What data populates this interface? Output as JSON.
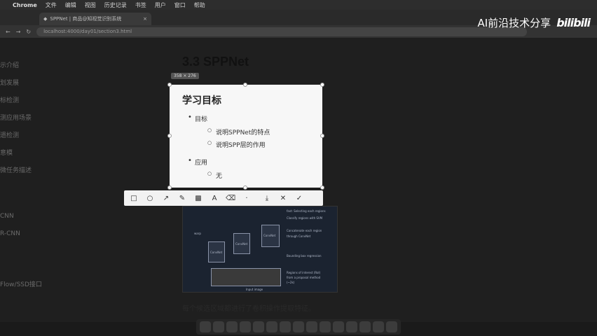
{
  "menubar": {
    "apple": "",
    "app": "Chrome",
    "items": [
      "文件",
      "编辑",
      "视图",
      "历史记录",
      "书签",
      "用户",
      "窗口",
      "帮助"
    ]
  },
  "tab": {
    "title": "SPPNet | 商品@知视觉识别系统",
    "close": "×"
  },
  "address": {
    "url": "localhost:4000/day01/section3.html"
  },
  "watermark": {
    "text": "AI前沿技术分享",
    "logo": "bilibili"
  },
  "sidebar": {
    "items": [
      "示介绍",
      "划发展",
      "标检测",
      "测应用场景",
      "遗检测",
      "意模",
      "微任务描述",
      "",
      "CNN",
      "R-CNN",
      "",
      "Flow/SSD接口"
    ]
  },
  "content": {
    "title": "3.3 SPPNet",
    "size_badge": "358 × 276",
    "caption": "每个候选区域都进行了卷积操作提取特征。"
  },
  "capture": {
    "heading": "学习目标",
    "items": [
      {
        "level": 1,
        "text": "目标"
      },
      {
        "level": 2,
        "text": "说明SPPNet的特点"
      },
      {
        "level": 2,
        "text": "说明SPP层的作用"
      },
      {
        "level": 1,
        "text": "应用"
      },
      {
        "level": 2,
        "text": "无"
      }
    ]
  },
  "toolbar": {
    "tools": [
      {
        "name": "rectangle-tool-icon",
        "glyph": "□"
      },
      {
        "name": "ellipse-tool-icon",
        "glyph": "○"
      },
      {
        "name": "arrow-tool-icon",
        "glyph": "↗"
      },
      {
        "name": "pen-tool-icon",
        "glyph": "✎"
      },
      {
        "name": "mosaic-tool-icon",
        "glyph": "▩"
      },
      {
        "name": "text-tool-icon",
        "glyph": "A"
      },
      {
        "name": "eraser-tool-icon",
        "glyph": "⌫"
      },
      {
        "name": "undo-icon",
        "glyph": "·"
      },
      {
        "name": "download-icon",
        "glyph": "⤓"
      },
      {
        "name": "cancel-icon",
        "glyph": "✕"
      },
      {
        "name": "confirm-icon",
        "glyph": "✓"
      }
    ]
  },
  "diagram": {
    "labels": [
      "fast: Selecting each regions",
      "Classify regions with SVM",
      "Concatenate each region",
      "through ConvNet",
      "Bounding box regression",
      "warp",
      "Regions of interest (RoI)",
      "from a proposal method",
      "(~2k)",
      "Input image"
    ],
    "boxes": [
      "ConvNet",
      "ConvNet",
      "ConvNet"
    ]
  }
}
